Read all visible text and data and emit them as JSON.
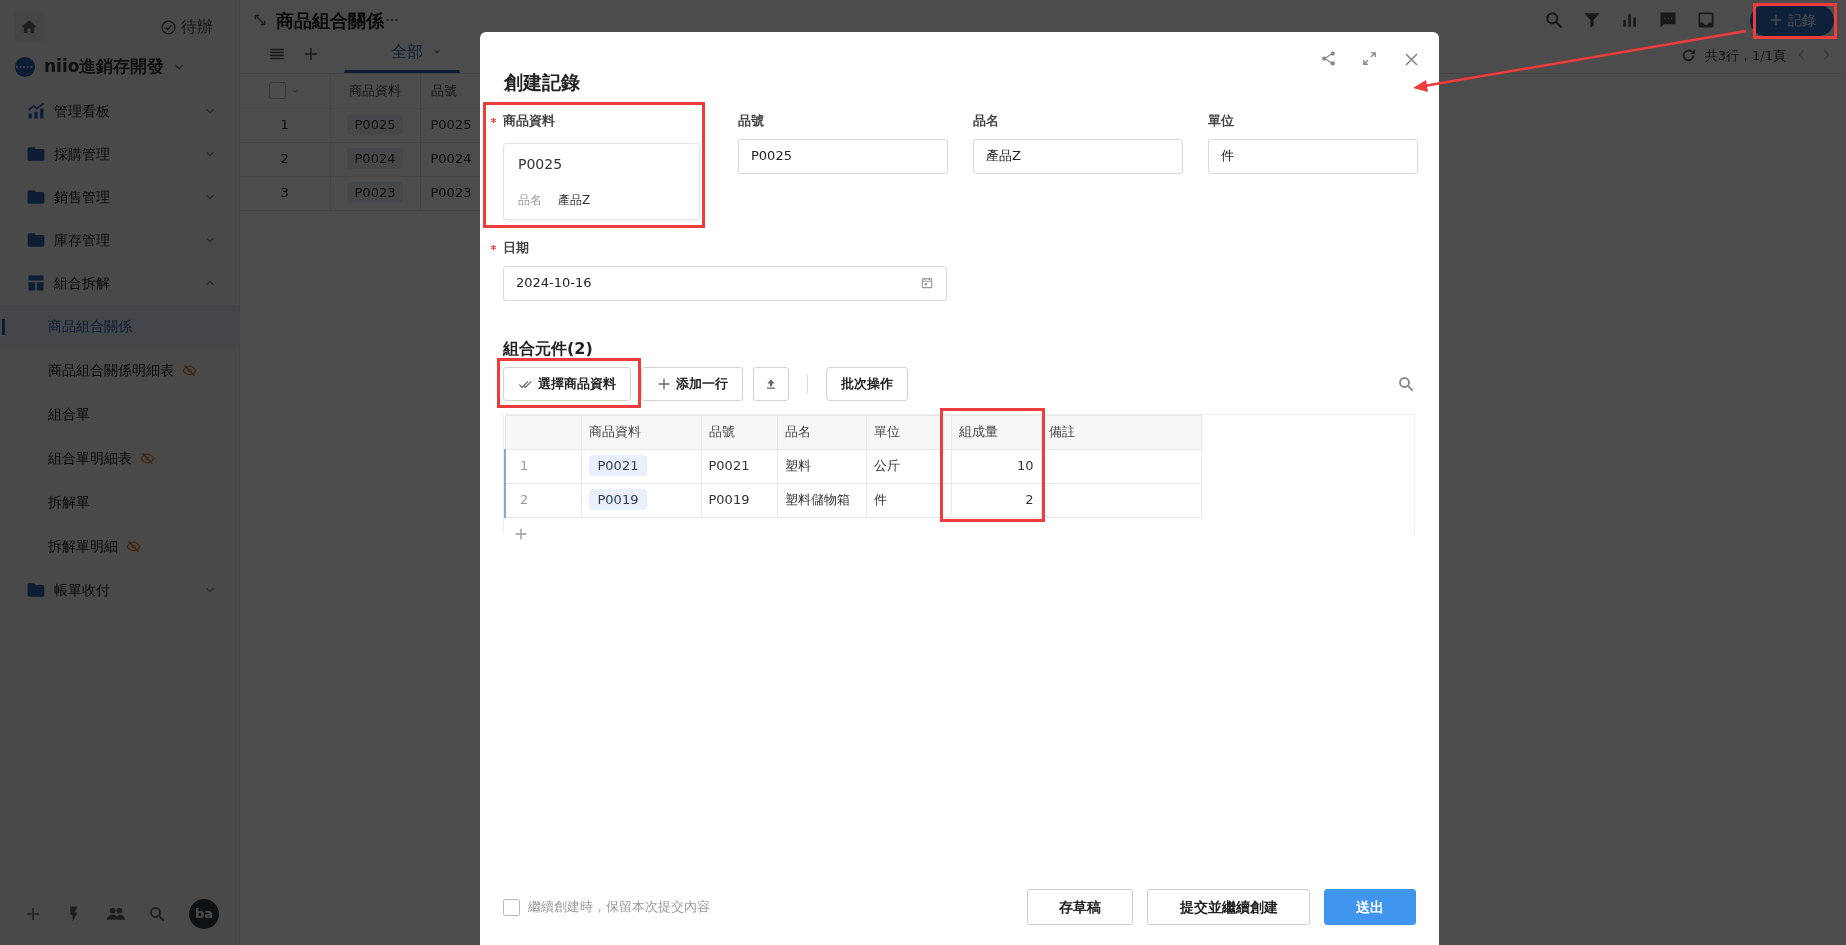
{
  "sidebar": {
    "todo": "待辦",
    "workspace": "niio進銷存開發",
    "items": [
      {
        "label": "管理看板",
        "expanded": false
      },
      {
        "label": "採購管理",
        "expanded": false
      },
      {
        "label": "銷售管理",
        "expanded": false
      },
      {
        "label": "庫存管理",
        "expanded": false
      },
      {
        "label": "組合拆解",
        "expanded": true,
        "children": [
          {
            "label": "商品組合關係",
            "selected": true,
            "hidden": false
          },
          {
            "label": "商品組合關係明細表",
            "selected": false,
            "hidden": true
          },
          {
            "label": "組合單",
            "selected": false,
            "hidden": false
          },
          {
            "label": "組合單明細表",
            "selected": false,
            "hidden": true
          },
          {
            "label": "拆解單",
            "selected": false,
            "hidden": false
          },
          {
            "label": "拆解單明細",
            "selected": false,
            "hidden": true
          }
        ]
      },
      {
        "label": "帳單收付",
        "expanded": false
      }
    ],
    "avatar": "ba"
  },
  "page": {
    "title": "商品組合關係",
    "views": [
      {
        "label": "全部",
        "selected": true
      }
    ],
    "add_button": "記錄",
    "summary": "共3行，1/1頁",
    "table": {
      "all_selected": false,
      "columns": [
        "商品資料",
        "品號"
      ],
      "rows": [
        {
          "index": "1",
          "product": "P0025",
          "code": "P0025"
        },
        {
          "index": "2",
          "product": "P0024",
          "code": "P0024"
        },
        {
          "index": "3",
          "product": "P0023",
          "code": "P0023"
        }
      ]
    }
  },
  "dialog": {
    "title": "創建記錄",
    "fields": [
      {
        "kind": "record",
        "label": "商品資料",
        "required": true,
        "code": "P0025",
        "sub_label": "品名",
        "sub_value": "產品Z"
      },
      {
        "kind": "text",
        "label": "品號",
        "required": false,
        "value": "P0025"
      },
      {
        "kind": "text",
        "label": "品名",
        "required": false,
        "value": "產品Z"
      },
      {
        "kind": "text",
        "label": "單位",
        "required": false,
        "value": "件"
      },
      {
        "kind": "date",
        "label": "日期",
        "required": true,
        "value": "2024-10-16"
      }
    ],
    "section": {
      "title": "組合元件(2)",
      "toolbar": [
        {
          "kind": "icon-text",
          "label": "選擇商品資料"
        },
        {
          "kind": "icon-text",
          "label": "添加一行"
        },
        {
          "kind": "icon"
        },
        {
          "kind": "text",
          "label": "批次操作"
        }
      ],
      "columns": [
        "商品資料",
        "品號",
        "品名",
        "單位",
        "組成量",
        "備註"
      ],
      "rows": [
        {
          "index": "1",
          "product": "P0021",
          "code": "P0021",
          "name": "塑料",
          "unit": "公斤",
          "quantity": "10"
        },
        {
          "index": "2",
          "product": "P0019",
          "code": "P0019",
          "name": "塑料儲物箱",
          "unit": "件",
          "quantity": "2"
        }
      ]
    },
    "keep_option": {
      "label": "繼續創建時，保留本次提交內容",
      "checked": false
    },
    "buttons": [
      {
        "label": "存草稿",
        "kind": "default"
      },
      {
        "label": "提交並繼續創建",
        "kind": "default"
      },
      {
        "label": "送出",
        "kind": "primary"
      }
    ]
  }
}
